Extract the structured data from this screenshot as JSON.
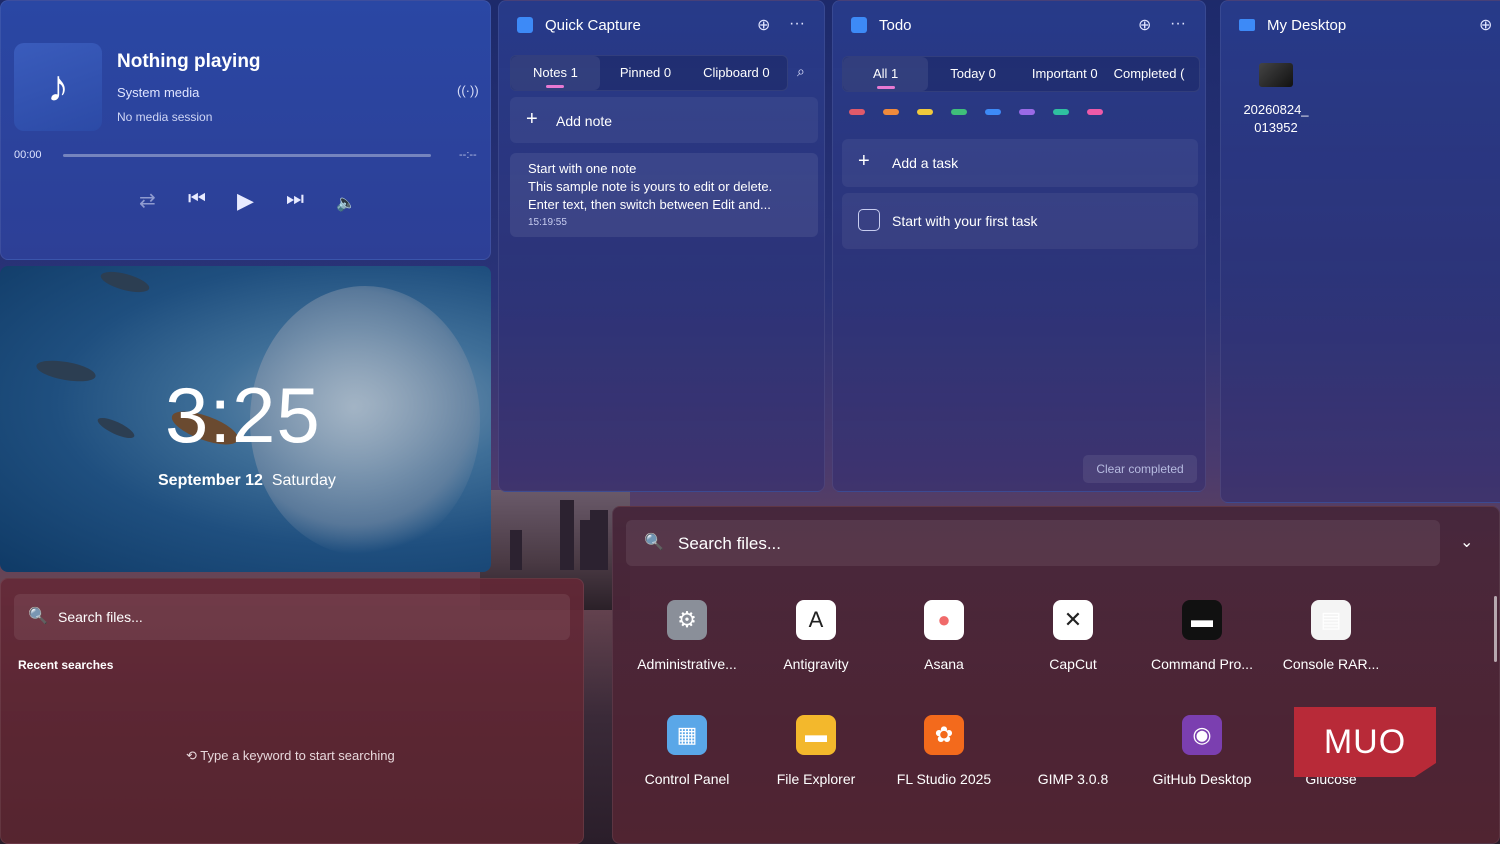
{
  "media": {
    "title": "Nothing playing",
    "source": "System media",
    "session": "No media session",
    "time_current": "00:00",
    "time_total": "--:--",
    "progress": 0
  },
  "clock": {
    "time": "3:25",
    "date": "September 12",
    "weekday": "Saturday"
  },
  "quick_capture": {
    "title": "Quick Capture",
    "tabs": [
      "Notes 1",
      "Pinned 0",
      "Clipboard 0"
    ],
    "add_label": "Add note",
    "note": {
      "title": "Start with one note",
      "line1": "This sample note is yours to edit or delete.",
      "line2": "Enter text, then switch between Edit and...",
      "time": "15:19:55"
    }
  },
  "todo": {
    "title": "Todo",
    "tabs": [
      "All 1",
      "Today 0",
      "Important 0",
      "Completed ("
    ],
    "colors": [
      "#e05a6a",
      "#f08a3c",
      "#f0c93c",
      "#3fbf7a",
      "#3d8af7",
      "#9a6ae6",
      "#2fc0a0",
      "#ee5aa8"
    ],
    "add_label": "Add a task",
    "task": "Start with your first task",
    "clear_label": "Clear completed"
  },
  "desktop": {
    "title": "My Desktop",
    "file_line1": "20260824_",
    "file_line2": "013952"
  },
  "search_small": {
    "placeholder": "Search files...",
    "recent_label": "Recent searches",
    "hint": "Type a keyword to start searching"
  },
  "launcher": {
    "placeholder": "Search files...",
    "apps": [
      {
        "label": "Administrative...",
        "icon": "admin-tools-icon"
      },
      {
        "label": "Antigravity",
        "icon": "antigravity-icon"
      },
      {
        "label": "Asana",
        "icon": "asana-icon"
      },
      {
        "label": "CapCut",
        "icon": "capcut-icon"
      },
      {
        "label": "Command Pro...",
        "icon": "command-prompt-icon"
      },
      {
        "label": "Console RAR...",
        "icon": "document-icon"
      },
      {
        "label": "Control Panel",
        "icon": "control-panel-icon"
      },
      {
        "label": "File Explorer",
        "icon": "folder-icon"
      },
      {
        "label": "FL Studio 2025",
        "icon": "fl-studio-icon"
      },
      {
        "label": "GIMP 3.0.8",
        "icon": "gimp-icon"
      },
      {
        "label": "GitHub Desktop",
        "icon": "github-icon"
      },
      {
        "label": "Glucose",
        "icon": "glucose-icon"
      }
    ]
  },
  "watermark": "MUO"
}
